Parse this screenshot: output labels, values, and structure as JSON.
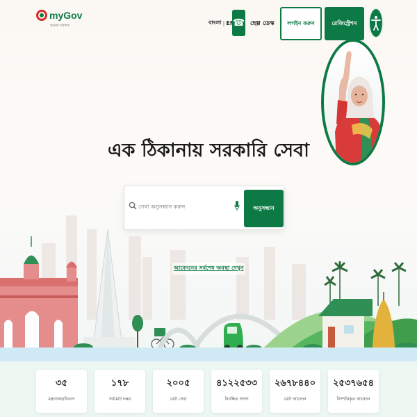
{
  "header": {
    "logo_text": "myGov",
    "logo_subtitle": "আমার সরকার",
    "lang_bn": "বাংলা",
    "lang_en": "ENG",
    "helpdesk_label": "হেল্প ডেস্ক",
    "login_label": "লগইন করুন",
    "register_label": "রেজিস্ট্রেশন",
    "icons": {
      "phone": "phone-icon",
      "accessibility": "accessibility-icon",
      "logo": "mygov-logo-icon"
    }
  },
  "hero": {
    "title": "এক ঠিকানায় সরকারি সেবা",
    "search_placeholder": "সেবা অনুসন্ধান করুন",
    "search_button": "অনুসন্ধান",
    "status_link": "আবেদনের সর্বশেষ অবস্থা দেখুন"
  },
  "stats": [
    {
      "value": "৩৫",
      "label": "মন্ত্রণালয়/বিভাগ"
    },
    {
      "value": "১৭৮",
      "label": "সর্বমোট দপ্তর"
    },
    {
      "value": "২০০৫",
      "label": "মোট সেবা"
    },
    {
      "value": "৪১২২৫৩৩",
      "label": "নিবন্ধিত সদস্য"
    },
    {
      "value": "২৬৭৮৪৪০",
      "label": "মোট আবেদন"
    },
    {
      "value": "২৫৩৭৬৫৪",
      "label": "নিষ্পত্তিকৃত আবেদন"
    }
  ],
  "colors": {
    "brand_green": "#0d7a46",
    "accent_red": "#d62b2b",
    "background": "#fbf7f3"
  }
}
